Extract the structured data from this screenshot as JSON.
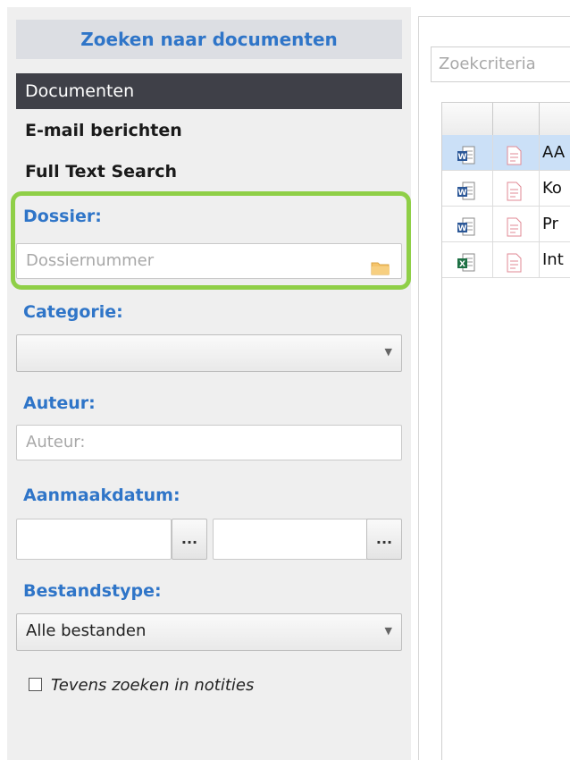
{
  "panel": {
    "title": "Zoeken naar documenten"
  },
  "nav": [
    {
      "label": "Documenten"
    },
    {
      "label": "E-mail berichten"
    },
    {
      "label": "Full Text Search"
    }
  ],
  "form": {
    "dossier": {
      "label": "Dossier:",
      "placeholder": "Dossiernummer",
      "icon": "folder-icon"
    },
    "categorie": {
      "label": "Categorie:",
      "value": ""
    },
    "auteur": {
      "label": "Auteur:",
      "placeholder": "Auteur:"
    },
    "aanmaakdatum": {
      "label": "Aanmaakdatum:",
      "from_button": "...",
      "to_button": "..."
    },
    "bestandstype": {
      "label": "Bestandstype:",
      "value": "Alle bestanden"
    },
    "notities": {
      "label": "Tevens zoeken in notities",
      "checked": false
    }
  },
  "results": {
    "search_placeholder": "Zoekcriteria",
    "rows": [
      {
        "type_icon": "word-doc-icon",
        "note_icon": "note-icon",
        "name": "AA"
      },
      {
        "type_icon": "word-doc-icon",
        "note_icon": "note-icon",
        "name": "Ko"
      },
      {
        "type_icon": "word-doc-icon",
        "note_icon": "note-icon",
        "name": "Pr"
      },
      {
        "type_icon": "excel-doc-icon",
        "note_icon": "note-icon",
        "name": "Int"
      }
    ]
  },
  "colors": {
    "accent": "#2f75c8",
    "highlight": "#8fcf47",
    "selection": "#cbe0f7",
    "nav_selected": "#3f4048"
  }
}
